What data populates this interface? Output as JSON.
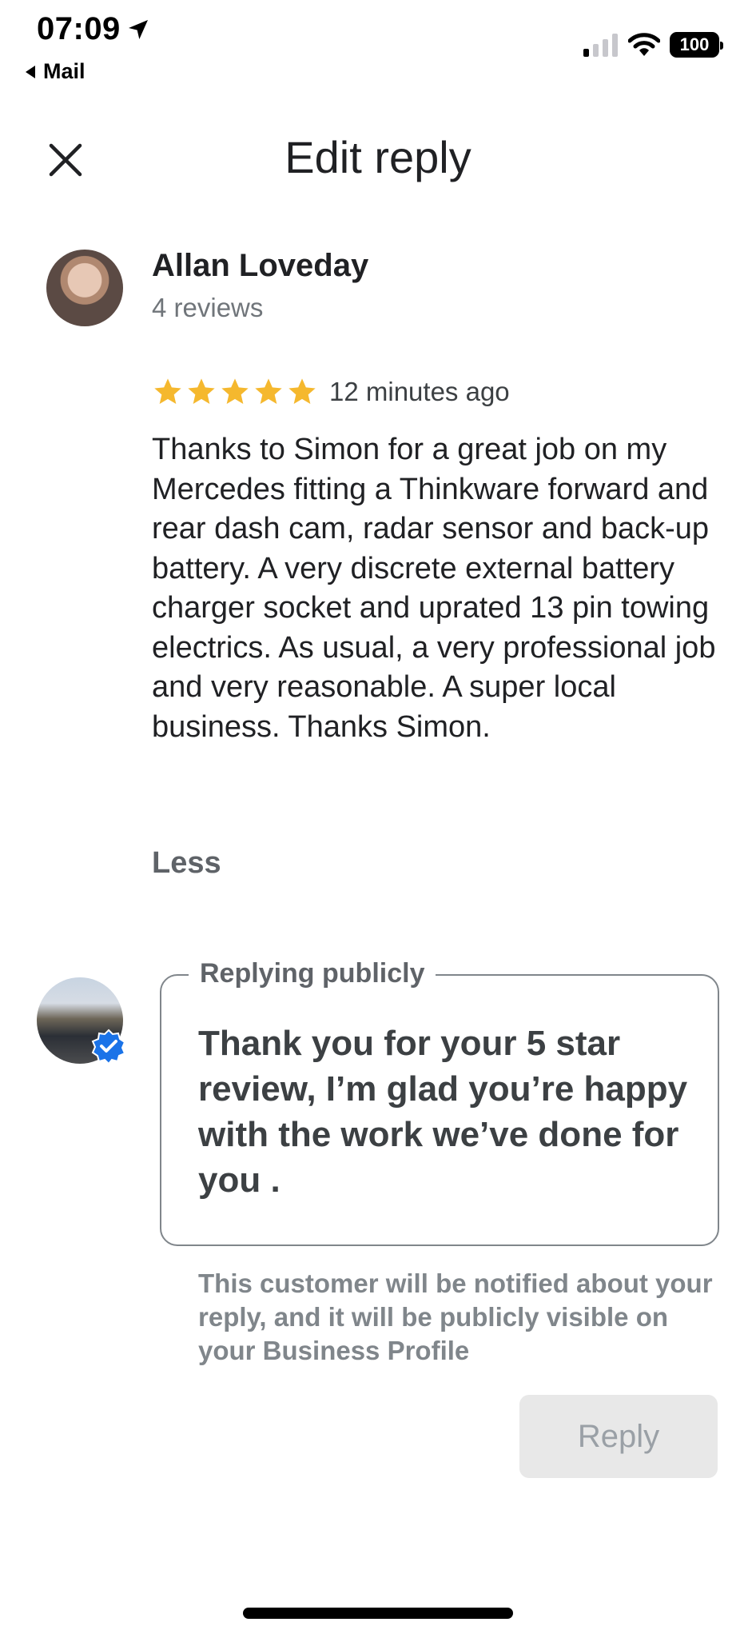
{
  "status_bar": {
    "time": "07:09",
    "back_label": "Mail",
    "battery": "100"
  },
  "header": {
    "title": "Edit reply"
  },
  "review": {
    "author": "Allan Loveday",
    "author_reviews": "4 reviews",
    "rating": 5,
    "max_rating": 5,
    "time_ago": "12 minutes ago",
    "text": "Thanks to Simon for a great job on my Mercedes fitting a Thinkware forward and rear dash cam, radar sensor and back-up battery. A very discrete external battery charger socket and uprated 13 pin towing electrics. As usual, a very professional job and very reasonable. A super local business. Thanks Simon.",
    "less_label": "Less"
  },
  "reply": {
    "label": "Replying publicly",
    "text": "Thank you for your 5 star review, I’m glad you’re happy with the work we’ve done for you .",
    "notice": "This customer will be notified about your reply, and it will be publicly visible on your Business Profile",
    "button_label": "Reply"
  },
  "colors": {
    "star": "#F5B82E",
    "verified": "#1A73E8",
    "button_disabled_bg": "#E8E8E8"
  }
}
